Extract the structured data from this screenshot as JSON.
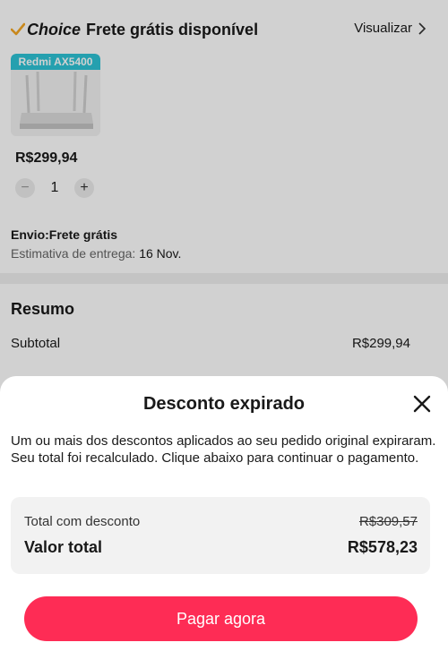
{
  "store": {
    "choice_label": "Choice",
    "title": "Frete grátis disponível",
    "view_link": "Visualizar",
    "product": {
      "badge": "Redmi AX5400",
      "price": "R$299,94",
      "quantity": "1",
      "minus": "−",
      "plus": "+"
    },
    "shipping_label": "Envio:Frete grátis",
    "estimate_label": "Estimativa de entrega: ",
    "estimate_date": "16 Nov."
  },
  "summary": {
    "title": "Resumo",
    "subtotal_label": "Subtotal",
    "subtotal_value": "R$299,94"
  },
  "modal": {
    "title": "Desconto expirado",
    "message": "Um ou mais dos descontos aplicados ao seu pedido original expiraram. Seu total foi recalculado. Clique abaixo para continuar o pagamento.",
    "discount_total_label": "Total com desconto",
    "discount_total_value": "R$309,57",
    "total_label": "Valor total",
    "total_value": "R$578,23",
    "pay_button": "Pagar agora"
  },
  "colors": {
    "accent": "#fe2c55",
    "badge": "#2ec4d6",
    "choice_check": "#f5a623"
  }
}
